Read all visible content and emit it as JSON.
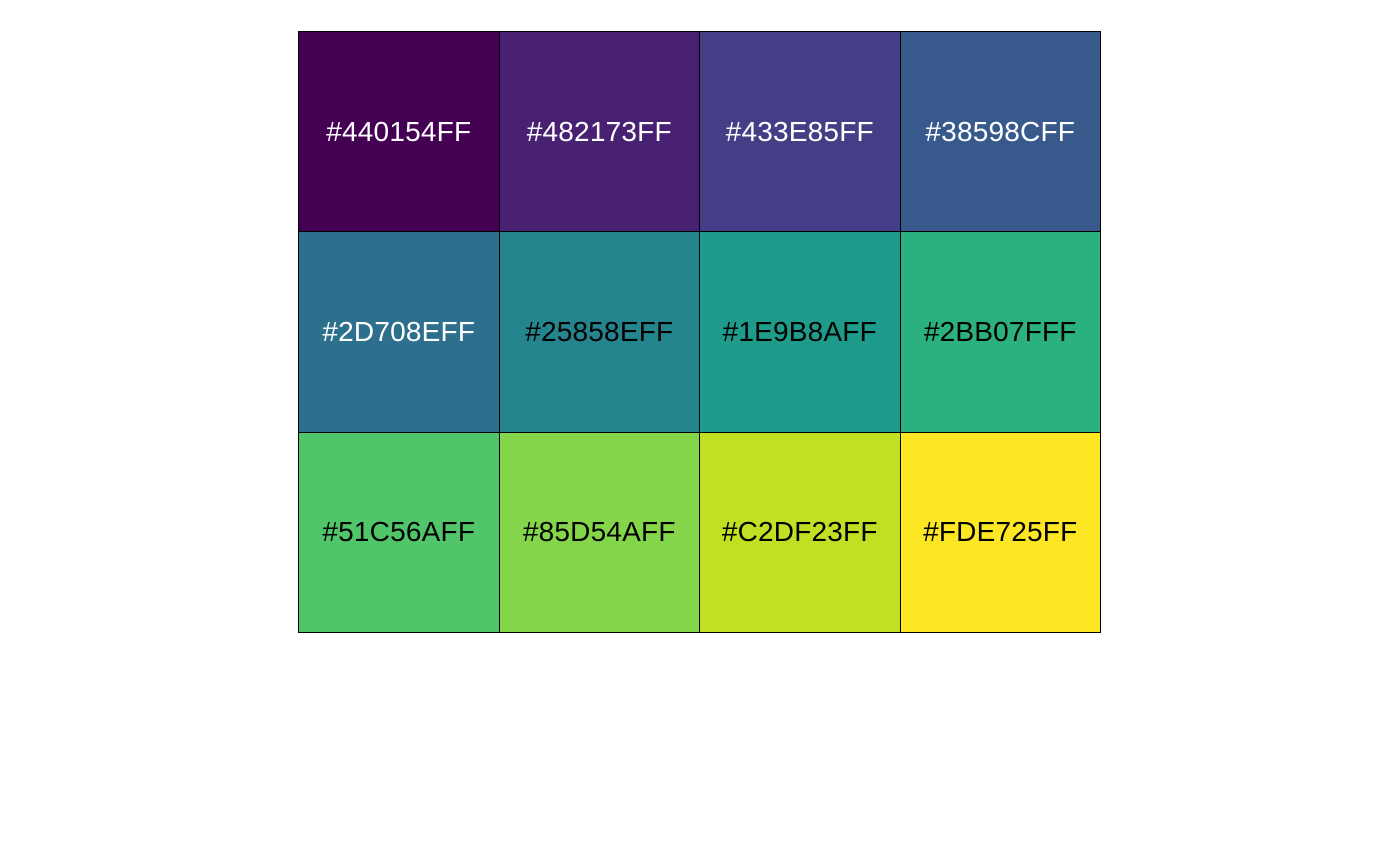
{
  "swatches": [
    {
      "label": "#440154FF",
      "color": "#440154",
      "text_color": "#FFFFFF"
    },
    {
      "label": "#482173FF",
      "color": "#482173",
      "text_color": "#FFFFFF"
    },
    {
      "label": "#433E85FF",
      "color": "#433E85",
      "text_color": "#FFFFFF"
    },
    {
      "label": "#38598CFF",
      "color": "#38598C",
      "text_color": "#FFFFFF"
    },
    {
      "label": "#2D708EFF",
      "color": "#2D708E",
      "text_color": "#FFFFFF"
    },
    {
      "label": "#25858EFF",
      "color": "#25858E",
      "text_color": "#000000"
    },
    {
      "label": "#1E9B8AFF",
      "color": "#1E9B8A",
      "text_color": "#000000"
    },
    {
      "label": "#2BB07FFF",
      "color": "#2BB07F",
      "text_color": "#000000"
    },
    {
      "label": "#51C56AFF",
      "color": "#51C56A",
      "text_color": "#000000"
    },
    {
      "label": "#85D54AFF",
      "color": "#85D54A",
      "text_color": "#000000"
    },
    {
      "label": "#C2DF23FF",
      "color": "#C2DF23",
      "text_color": "#000000"
    },
    {
      "label": "#FDE725FF",
      "color": "#FDE725",
      "text_color": "#000000"
    }
  ]
}
